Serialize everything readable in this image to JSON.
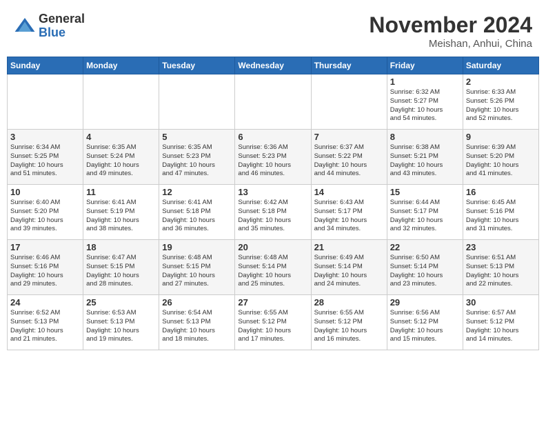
{
  "header": {
    "logo_general": "General",
    "logo_blue": "Blue",
    "month_title": "November 2024",
    "location": "Meishan, Anhui, China"
  },
  "weekdays": [
    "Sunday",
    "Monday",
    "Tuesday",
    "Wednesday",
    "Thursday",
    "Friday",
    "Saturday"
  ],
  "weeks": [
    [
      {
        "day": "",
        "info": ""
      },
      {
        "day": "",
        "info": ""
      },
      {
        "day": "",
        "info": ""
      },
      {
        "day": "",
        "info": ""
      },
      {
        "day": "",
        "info": ""
      },
      {
        "day": "1",
        "info": "Sunrise: 6:32 AM\nSunset: 5:27 PM\nDaylight: 10 hours\nand 54 minutes."
      },
      {
        "day": "2",
        "info": "Sunrise: 6:33 AM\nSunset: 5:26 PM\nDaylight: 10 hours\nand 52 minutes."
      }
    ],
    [
      {
        "day": "3",
        "info": "Sunrise: 6:34 AM\nSunset: 5:25 PM\nDaylight: 10 hours\nand 51 minutes."
      },
      {
        "day": "4",
        "info": "Sunrise: 6:35 AM\nSunset: 5:24 PM\nDaylight: 10 hours\nand 49 minutes."
      },
      {
        "day": "5",
        "info": "Sunrise: 6:35 AM\nSunset: 5:23 PM\nDaylight: 10 hours\nand 47 minutes."
      },
      {
        "day": "6",
        "info": "Sunrise: 6:36 AM\nSunset: 5:23 PM\nDaylight: 10 hours\nand 46 minutes."
      },
      {
        "day": "7",
        "info": "Sunrise: 6:37 AM\nSunset: 5:22 PM\nDaylight: 10 hours\nand 44 minutes."
      },
      {
        "day": "8",
        "info": "Sunrise: 6:38 AM\nSunset: 5:21 PM\nDaylight: 10 hours\nand 43 minutes."
      },
      {
        "day": "9",
        "info": "Sunrise: 6:39 AM\nSunset: 5:20 PM\nDaylight: 10 hours\nand 41 minutes."
      }
    ],
    [
      {
        "day": "10",
        "info": "Sunrise: 6:40 AM\nSunset: 5:20 PM\nDaylight: 10 hours\nand 39 minutes."
      },
      {
        "day": "11",
        "info": "Sunrise: 6:41 AM\nSunset: 5:19 PM\nDaylight: 10 hours\nand 38 minutes."
      },
      {
        "day": "12",
        "info": "Sunrise: 6:41 AM\nSunset: 5:18 PM\nDaylight: 10 hours\nand 36 minutes."
      },
      {
        "day": "13",
        "info": "Sunrise: 6:42 AM\nSunset: 5:18 PM\nDaylight: 10 hours\nand 35 minutes."
      },
      {
        "day": "14",
        "info": "Sunrise: 6:43 AM\nSunset: 5:17 PM\nDaylight: 10 hours\nand 34 minutes."
      },
      {
        "day": "15",
        "info": "Sunrise: 6:44 AM\nSunset: 5:17 PM\nDaylight: 10 hours\nand 32 minutes."
      },
      {
        "day": "16",
        "info": "Sunrise: 6:45 AM\nSunset: 5:16 PM\nDaylight: 10 hours\nand 31 minutes."
      }
    ],
    [
      {
        "day": "17",
        "info": "Sunrise: 6:46 AM\nSunset: 5:16 PM\nDaylight: 10 hours\nand 29 minutes."
      },
      {
        "day": "18",
        "info": "Sunrise: 6:47 AM\nSunset: 5:15 PM\nDaylight: 10 hours\nand 28 minutes."
      },
      {
        "day": "19",
        "info": "Sunrise: 6:48 AM\nSunset: 5:15 PM\nDaylight: 10 hours\nand 27 minutes."
      },
      {
        "day": "20",
        "info": "Sunrise: 6:48 AM\nSunset: 5:14 PM\nDaylight: 10 hours\nand 25 minutes."
      },
      {
        "day": "21",
        "info": "Sunrise: 6:49 AM\nSunset: 5:14 PM\nDaylight: 10 hours\nand 24 minutes."
      },
      {
        "day": "22",
        "info": "Sunrise: 6:50 AM\nSunset: 5:14 PM\nDaylight: 10 hours\nand 23 minutes."
      },
      {
        "day": "23",
        "info": "Sunrise: 6:51 AM\nSunset: 5:13 PM\nDaylight: 10 hours\nand 22 minutes."
      }
    ],
    [
      {
        "day": "24",
        "info": "Sunrise: 6:52 AM\nSunset: 5:13 PM\nDaylight: 10 hours\nand 21 minutes."
      },
      {
        "day": "25",
        "info": "Sunrise: 6:53 AM\nSunset: 5:13 PM\nDaylight: 10 hours\nand 19 minutes."
      },
      {
        "day": "26",
        "info": "Sunrise: 6:54 AM\nSunset: 5:13 PM\nDaylight: 10 hours\nand 18 minutes."
      },
      {
        "day": "27",
        "info": "Sunrise: 6:55 AM\nSunset: 5:12 PM\nDaylight: 10 hours\nand 17 minutes."
      },
      {
        "day": "28",
        "info": "Sunrise: 6:55 AM\nSunset: 5:12 PM\nDaylight: 10 hours\nand 16 minutes."
      },
      {
        "day": "29",
        "info": "Sunrise: 6:56 AM\nSunset: 5:12 PM\nDaylight: 10 hours\nand 15 minutes."
      },
      {
        "day": "30",
        "info": "Sunrise: 6:57 AM\nSunset: 5:12 PM\nDaylight: 10 hours\nand 14 minutes."
      }
    ]
  ]
}
